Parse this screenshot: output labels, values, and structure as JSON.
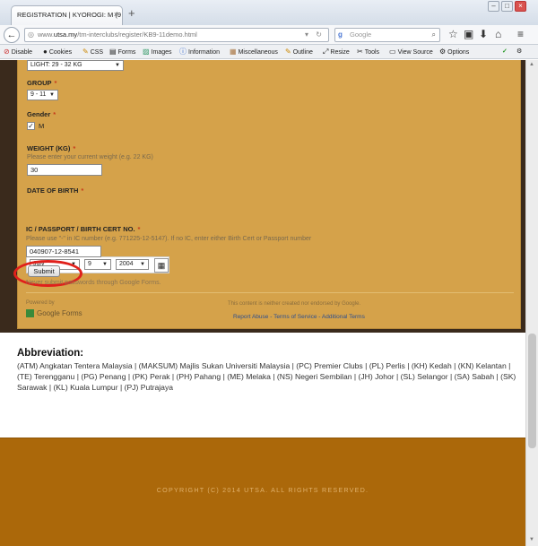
{
  "browser": {
    "tab_title": "REGISTRATION | KYOROGI: M (9 - ...",
    "url_prefix": "www.",
    "url_domain": "utsa.my",
    "url_path": "/tm-interclubs/register/KB9-11demo.html",
    "search_placeholder": "Google"
  },
  "devbar": {
    "items": [
      "Disable",
      "Cookies",
      "CSS",
      "Forms",
      "Images",
      "Information",
      "Miscellaneous",
      "Outline",
      "Resize",
      "Tools",
      "View Source",
      "Options"
    ]
  },
  "form": {
    "weight_class_value": "LIGHT: 29 - 32 KG",
    "group": {
      "label": "GROUP",
      "value": "9 - 11"
    },
    "gender": {
      "label": "Gender",
      "option": "M",
      "checked": true
    },
    "weight": {
      "label": "WEIGHT (KG)",
      "help": "Please enter your current weight (e.g. 22 KG)",
      "value": "30"
    },
    "dob": {
      "label": "DATE OF BIRTH",
      "month": "July",
      "day": "9",
      "year": "2004"
    },
    "ic": {
      "label": "IC / PASSPORT / BIRTH CERT NO.",
      "help": "Please use \"-\" in IC number (e.g. 771225-12-5147). If no IC, enter either Birth Cert or Passport number",
      "value": "040907-12-8541"
    },
    "submit_label": "Submit",
    "never_submit_text": "Never submit passwords through Google Forms.",
    "powered_by": "Powered by",
    "google_forms": "Google Forms",
    "disclaimer": "This content is neither created nor endorsed by Google.",
    "report_abuse": "Report Abuse",
    "terms": "Terms of Service",
    "additional_terms": "Additional Terms",
    "separator": " - "
  },
  "abbreviation": {
    "title": "Abbreviation:",
    "text": "(ATM) Angkatan Tentera Malaysia | (MAKSUM) Majlis Sukan Universiti Malaysia | (PC) Premier Clubs | (PL) Perlis | (KH) Kedah | (KN) Kelantan | (TE) Terengganu | (PG) Penang | (PK) Perak | (PH) Pahang | (ME) Melaka | (NS) Negeri Sembilan | (JH) Johor | (SL) Selangor | (SA) Sabah | (SK) Sarawak | (KL) Kuala Lumpur | (PJ) Putrajaya"
  },
  "footer": {
    "copyright": "COPYRIGHT (C) 2014 UTSA. ALL RIGHTS RESERVED."
  },
  "colors": {
    "form_bg": "#d5a24a",
    "footer_bg": "#ab680a",
    "required": "#c63b1b",
    "highlight": "#e0201b"
  }
}
